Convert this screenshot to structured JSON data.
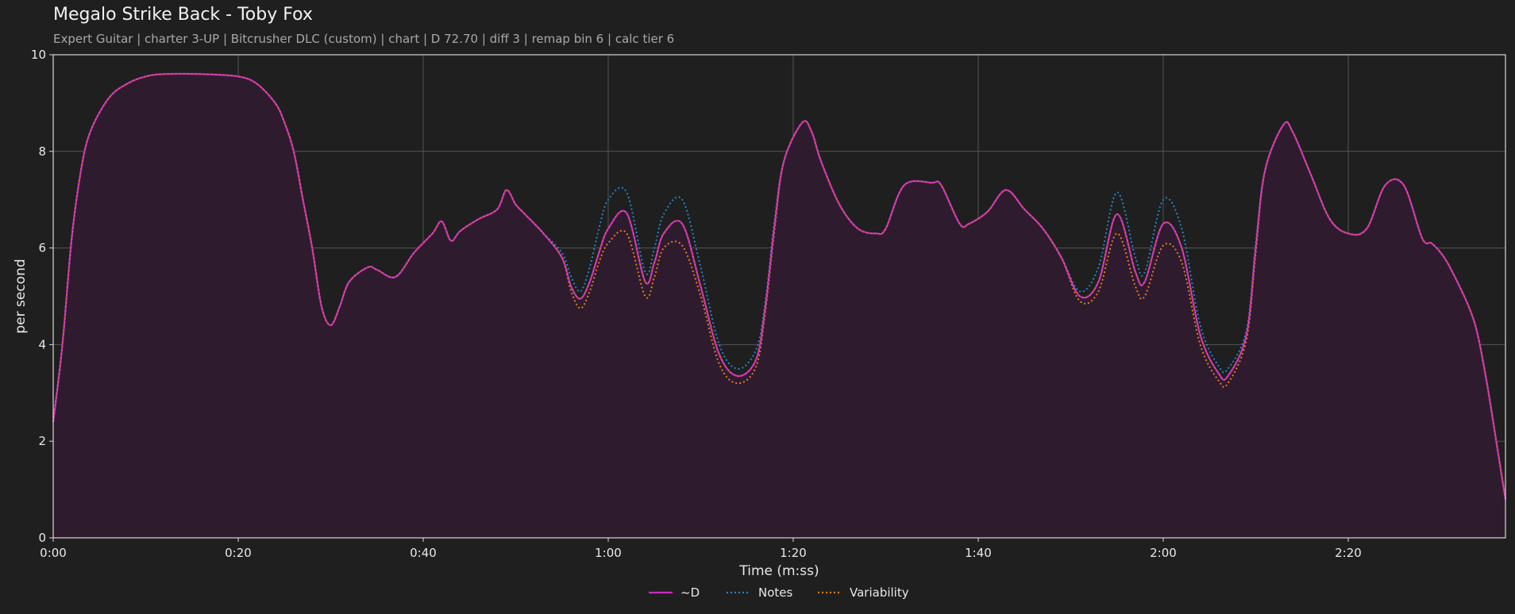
{
  "header": {
    "title": "Megalo Strike Back - Toby Fox",
    "subtitle": "Expert Guitar  |  charter 3-UP  |  Bitcrusher DLC (custom)  |  chart  |  D 72.70  |  diff 3  |  remap bin 6  |  calc tier 6"
  },
  "chart_data": {
    "type": "line",
    "xlabel": "Time (m:ss)",
    "ylabel": "per second",
    "xlim": [
      "0:00",
      "2:37"
    ],
    "ylim": [
      0,
      10
    ],
    "x_ticks": [
      "0:00",
      "0:20",
      "0:40",
      "1:00",
      "1:20",
      "1:40",
      "2:00",
      "2:20"
    ],
    "y_ticks": [
      "0",
      "2",
      "4",
      "6",
      "8",
      "10"
    ],
    "grid": true,
    "legend_position": "bottom-center",
    "x": [
      "0:00",
      "0:01",
      "0:02",
      "0:03",
      "0:04",
      "0:06",
      "0:08",
      "0:10",
      "0:12",
      "0:16",
      "0:20",
      "0:22",
      "0:24",
      "0:25",
      "0:26",
      "0:27",
      "0:28",
      "0:29",
      "0:30",
      "0:31",
      "0:32",
      "0:34",
      "0:35",
      "0:37",
      "0:39",
      "0:41",
      "0:42",
      "0:43",
      "0:44",
      "0:46",
      "0:48",
      "0:49",
      "0:50",
      "0:51",
      "0:53",
      "0:55",
      "0:56",
      "0:57",
      "0:58",
      "0:59",
      "1:00",
      "1:02",
      "1:04",
      "1:05",
      "1:06",
      "1:08",
      "1:10",
      "1:12",
      "1:14",
      "1:16",
      "1:17",
      "1:18",
      "1:19",
      "1:21",
      "1:22",
      "1:23",
      "1:25",
      "1:27",
      "1:29",
      "1:30",
      "1:32",
      "1:35",
      "1:36",
      "1:38",
      "1:39",
      "1:41",
      "1:43",
      "1:45",
      "1:47",
      "1:49",
      "1:51",
      "1:53",
      "1:55",
      "1:57",
      "1:58",
      "2:00",
      "2:02",
      "2:04",
      "2:06",
      "2:07",
      "2:09",
      "2:10",
      "2:11",
      "2:13",
      "2:14",
      "2:16",
      "2:18",
      "2:20",
      "2:22",
      "2:24",
      "2:26",
      "2:28",
      "2:29",
      "2:30",
      "2:31",
      "2:33",
      "2:34",
      "2:35",
      "2:36",
      "2:37"
    ],
    "series": [
      {
        "name": "~D",
        "color": "#c72cc2",
        "style": "solid",
        "values": [
          2.4,
          4.0,
          6.2,
          7.6,
          8.4,
          9.1,
          9.4,
          9.55,
          9.6,
          9.6,
          9.55,
          9.4,
          9.0,
          8.6,
          8.0,
          7.0,
          6.0,
          4.8,
          4.4,
          4.8,
          5.3,
          5.6,
          5.55,
          5.4,
          5.9,
          6.3,
          6.55,
          6.15,
          6.35,
          6.6,
          6.8,
          7.2,
          6.9,
          6.7,
          6.3,
          5.8,
          5.2,
          4.95,
          5.3,
          5.9,
          6.4,
          6.72,
          5.3,
          5.7,
          6.3,
          6.5,
          5.2,
          3.8,
          3.35,
          3.7,
          4.8,
          6.5,
          7.8,
          8.6,
          8.4,
          7.8,
          6.9,
          6.4,
          6.3,
          6.4,
          7.3,
          7.35,
          7.3,
          6.5,
          6.5,
          6.75,
          7.2,
          6.8,
          6.4,
          5.8,
          5.0,
          5.3,
          6.7,
          5.5,
          5.3,
          6.5,
          6.0,
          4.2,
          3.4,
          3.35,
          4.2,
          6.0,
          7.6,
          8.55,
          8.4,
          7.5,
          6.6,
          6.3,
          6.4,
          7.3,
          7.3,
          6.2,
          6.1,
          5.9,
          5.6,
          4.8,
          4.2,
          3.2,
          2.0,
          0.8
        ]
      },
      {
        "name": "Notes",
        "color": "#1f86c9",
        "style": "dotted",
        "values": [
          2.4,
          4.0,
          6.2,
          7.6,
          8.4,
          9.1,
          9.4,
          9.55,
          9.6,
          9.6,
          9.55,
          9.4,
          9.0,
          8.6,
          8.0,
          7.0,
          6.0,
          4.8,
          4.4,
          4.8,
          5.3,
          5.6,
          5.55,
          5.4,
          5.9,
          6.3,
          6.55,
          6.15,
          6.35,
          6.6,
          6.8,
          7.2,
          6.9,
          6.7,
          6.3,
          5.9,
          5.4,
          5.1,
          5.6,
          6.4,
          7.0,
          7.15,
          5.5,
          6.0,
          6.7,
          7.0,
          5.6,
          4.0,
          3.5,
          3.9,
          4.9,
          6.6,
          7.8,
          8.6,
          8.4,
          7.8,
          6.9,
          6.4,
          6.3,
          6.4,
          7.3,
          7.35,
          7.3,
          6.5,
          6.5,
          6.75,
          7.2,
          6.8,
          6.4,
          5.8,
          5.1,
          5.6,
          7.15,
          5.8,
          5.5,
          7.0,
          6.4,
          4.4,
          3.55,
          3.5,
          4.3,
          6.1,
          7.6,
          8.55,
          8.4,
          7.5,
          6.6,
          6.3,
          6.4,
          7.3,
          7.3,
          6.2,
          6.1,
          5.9,
          5.6,
          4.8,
          4.2,
          3.2,
          2.0,
          0.8
        ]
      },
      {
        "name": "Variability",
        "color": "#e57a1f",
        "style": "dotted",
        "values": [
          2.4,
          4.0,
          6.2,
          7.6,
          8.4,
          9.1,
          9.4,
          9.55,
          9.6,
          9.6,
          9.55,
          9.4,
          9.0,
          8.6,
          8.0,
          7.0,
          6.0,
          4.8,
          4.4,
          4.8,
          5.3,
          5.6,
          5.55,
          5.4,
          5.9,
          6.3,
          6.55,
          6.15,
          6.35,
          6.6,
          6.8,
          7.2,
          6.9,
          6.7,
          6.3,
          5.8,
          5.1,
          4.75,
          5.1,
          5.7,
          6.1,
          6.3,
          5.0,
          5.4,
          6.0,
          6.05,
          5.0,
          3.6,
          3.2,
          3.55,
          4.7,
          6.4,
          7.8,
          8.6,
          8.4,
          7.8,
          6.9,
          6.4,
          6.3,
          6.4,
          7.3,
          7.35,
          7.3,
          6.5,
          6.5,
          6.75,
          7.2,
          6.8,
          6.4,
          5.8,
          4.9,
          5.1,
          6.3,
          5.2,
          5.0,
          6.05,
          5.7,
          4.0,
          3.25,
          3.2,
          4.1,
          5.9,
          7.6,
          8.55,
          8.4,
          7.5,
          6.6,
          6.3,
          6.4,
          7.3,
          7.3,
          6.2,
          6.1,
          5.9,
          5.6,
          4.8,
          4.2,
          3.2,
          2.0,
          0.8
        ]
      }
    ],
    "area_fill": "#2e1c2e",
    "legend": [
      "~D",
      "Notes",
      "Variability"
    ]
  }
}
